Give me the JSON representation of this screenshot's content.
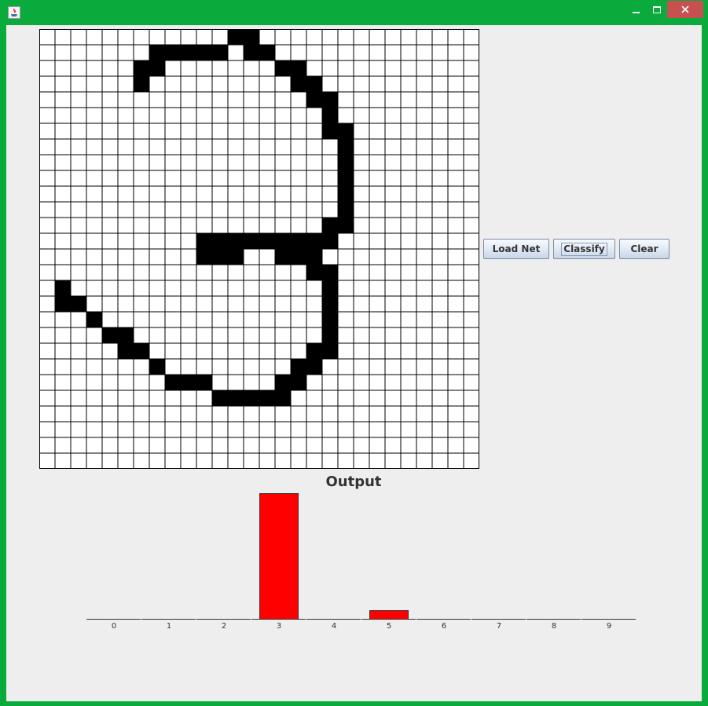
{
  "window": {
    "buttons": [
      "minimize-icon",
      "maximize-icon",
      "close-icon"
    ],
    "frame_color": "#0aaa3c",
    "close_color": "#c75050"
  },
  "canvas": {
    "rows": 28,
    "cols": 28,
    "filled_runs": [
      [
        0,
        12,
        13
      ],
      [
        1,
        7,
        11
      ],
      [
        1,
        13,
        14
      ],
      [
        2,
        6,
        7
      ],
      [
        2,
        15,
        16
      ],
      [
        3,
        6,
        6
      ],
      [
        3,
        16,
        17
      ],
      [
        4,
        17,
        18
      ],
      [
        5,
        18,
        18
      ],
      [
        6,
        18,
        19
      ],
      [
        7,
        19,
        19
      ],
      [
        8,
        19,
        19
      ],
      [
        9,
        19,
        19
      ],
      [
        10,
        19,
        19
      ],
      [
        11,
        19,
        19
      ],
      [
        12,
        18,
        19
      ],
      [
        13,
        10,
        18
      ],
      [
        14,
        10,
        12
      ],
      [
        14,
        15,
        17
      ],
      [
        15,
        17,
        18
      ],
      [
        16,
        1,
        1
      ],
      [
        16,
        18,
        18
      ],
      [
        17,
        1,
        2
      ],
      [
        17,
        18,
        18
      ],
      [
        18,
        3,
        3
      ],
      [
        18,
        18,
        18
      ],
      [
        19,
        4,
        5
      ],
      [
        19,
        18,
        18
      ],
      [
        20,
        5,
        6
      ],
      [
        20,
        17,
        18
      ],
      [
        21,
        7,
        7
      ],
      [
        21,
        16,
        17
      ],
      [
        22,
        8,
        10
      ],
      [
        22,
        15,
        16
      ],
      [
        23,
        11,
        15
      ]
    ]
  },
  "controls": {
    "load_label": "Load Net",
    "classify_label": "Classify",
    "clear_label": "Clear"
  },
  "chart_data": {
    "type": "bar",
    "title": "Output",
    "categories": [
      "0",
      "1",
      "2",
      "3",
      "4",
      "5",
      "6",
      "7",
      "8",
      "9"
    ],
    "values": [
      0,
      0,
      0,
      1.0,
      0,
      0.07,
      0,
      0,
      0,
      0
    ],
    "ylim": [
      0,
      1.0
    ],
    "bar_color": "#ff0000",
    "xlabel": "",
    "ylabel": "",
    "grid": false
  }
}
